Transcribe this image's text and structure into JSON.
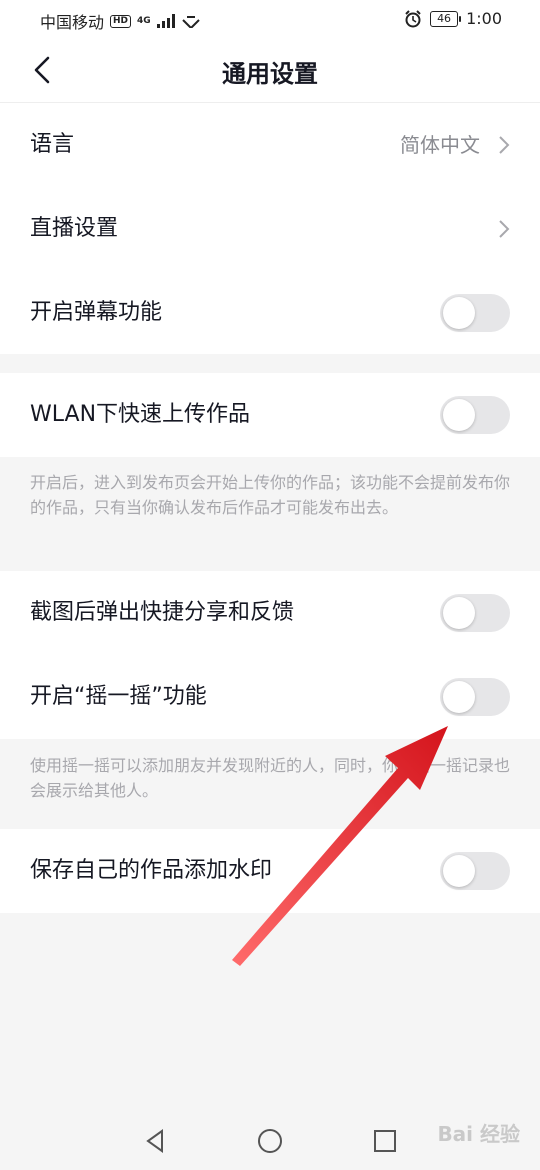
{
  "status_bar": {
    "carrier": "中国移动",
    "hd": "HD",
    "network": "4G",
    "battery": "46",
    "time": "1:00"
  },
  "header": {
    "title": "通用设置"
  },
  "settings": {
    "language_label": "语言",
    "language_value": "简体中文",
    "live_label": "直播设置",
    "danmaku_label": "开启弹幕功能",
    "danmaku_on": false,
    "wlan_label": "WLAN下快速上传作品",
    "wlan_on": false,
    "wlan_desc": "开启后，进入到发布页会开始上传你的作品；该功能不会提前发布你的作品，只有当你确认发布后作品才可能发布出去。",
    "screenshot_label": "截图后弹出快捷分享和反馈",
    "screenshot_on": false,
    "shake_label": "开启“摇一摇”功能",
    "shake_on": false,
    "shake_desc": "使用摇一摇可以添加朋友并发现附近的人，同时，你的摇一摇记录也会展示给其他人。",
    "watermark_label": "保存自己的作品添加水印",
    "watermark_on": false
  },
  "icons": {
    "back": "chevron-left-icon",
    "chevron": "chevron-right-icon",
    "nav_back": "triangle-back-icon",
    "nav_home": "circle-home-icon",
    "nav_recent": "square-recent-icon"
  },
  "colors": {
    "annotation_arrow": "#e8232b",
    "toggle_off": "#e6e6e8"
  },
  "watermark_text": "Bai 经验"
}
